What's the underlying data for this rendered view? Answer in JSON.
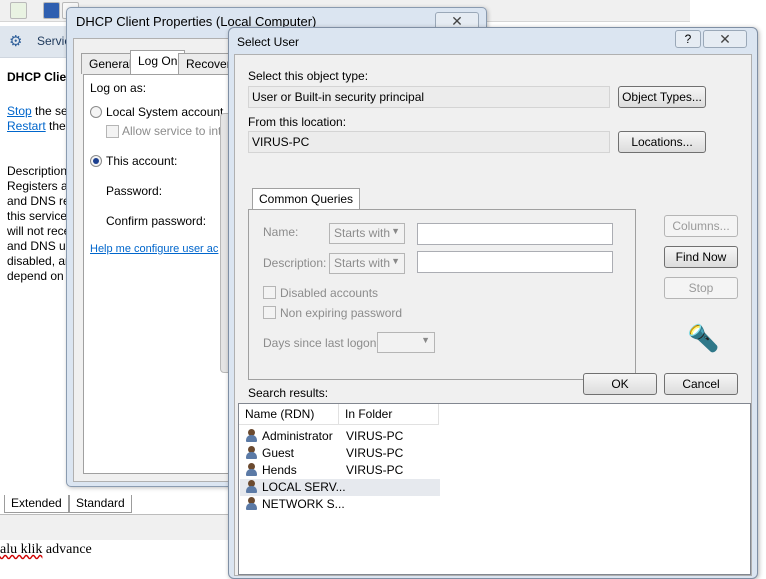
{
  "background_window": {
    "header_title": "Servic",
    "service_title": "DHCP Clien",
    "stop_link": "Stop",
    "stop_rest": " the ser",
    "restart_link": "Restart",
    "restart_rest": " the",
    "description_lines": [
      "Description",
      "Registers ar",
      "and DNS re",
      "this service",
      "will not rece",
      "and DNS up",
      "disabled, ar",
      "depend on"
    ],
    "tabs": [
      "Extended",
      "Standard"
    ],
    "document_text_prefix": "",
    "document_text_squiggle": "alu klik",
    "document_text_rest": " advance"
  },
  "dhcp_dialog": {
    "title": "DHCP Client Properties (Local Computer)",
    "tabs": [
      "General",
      "Log On",
      "Recovery"
    ],
    "active_tab": "Log On",
    "log_on_as_label": "Log on as:",
    "local_system_label": "Local System account",
    "allow_service_label": "Allow service to inte",
    "this_account_label": "This account:",
    "password_label": "Password:",
    "confirm_password_label": "Confirm password:",
    "help_link": "Help me configure user ac"
  },
  "select_user_dialog": {
    "title": "Select User",
    "help_button": "?",
    "object_type_label": "Select this object type:",
    "object_type_value": "User or Built-in security principal",
    "object_types_button": "Object Types...",
    "location_label": "From this location:",
    "location_value": "VIRUS-PC",
    "locations_button": "Locations...",
    "common_queries_tab": "Common Queries",
    "name_label": "Name:",
    "name_match": "Starts with",
    "description_label": "Description:",
    "description_match": "Starts with",
    "disabled_accounts_label": "Disabled accounts",
    "non_expiring_label": "Non expiring password",
    "days_since_logon_label": "Days since last logon:",
    "columns_button": "Columns...",
    "find_now_button": "Find Now",
    "stop_button": "Stop",
    "ok_button": "OK",
    "cancel_button": "Cancel",
    "search_results_label": "Search results:",
    "columns": [
      "Name (RDN)",
      "In Folder"
    ],
    "results": [
      {
        "name": "Administrator",
        "folder": "VIRUS-PC"
      },
      {
        "name": "Guest",
        "folder": "VIRUS-PC"
      },
      {
        "name": "Hends",
        "folder": "VIRUS-PC"
      },
      {
        "name": "LOCAL SERV...",
        "folder": ""
      },
      {
        "name": "NETWORK S...",
        "folder": ""
      }
    ]
  },
  "colors": {
    "dialog_frame": "#dbe5f1",
    "link": "#0066cc",
    "selected_row": "#e6e9ee"
  }
}
